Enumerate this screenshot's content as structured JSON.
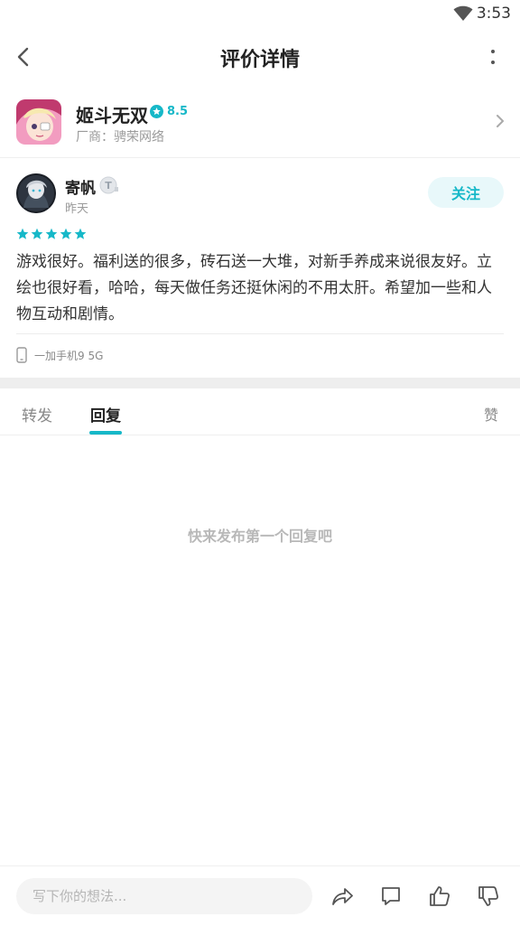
{
  "status": {
    "time": "3:53",
    "wifi_icon": "wifi-icon"
  },
  "header": {
    "title": "评价详情",
    "back_icon": "back-arrow-icon",
    "more_icon": "more-vertical-icon"
  },
  "app": {
    "name": "姬斗无双",
    "rating": "8.5",
    "vendor": "厂商：骋荣网络",
    "icon": "app-icon"
  },
  "review": {
    "user": "寄帆",
    "badge": "T",
    "date": "昨天",
    "follow_label": "关注",
    "stars": 5,
    "text": "游戏很好。福利送的很多，砖石送一大堆，对新手养成来说很友好。立绘也很好看，哈哈，每天做任务还挺休闲的不用太肝。希望加一些和人物互动和剧情。",
    "device": "一加手机9 5G"
  },
  "tabs": {
    "forward": "转发",
    "reply": "回复",
    "likes": "赞"
  },
  "empty_state": "快来发布第一个回复吧",
  "composer": {
    "placeholder": "写下你的想法..."
  },
  "colors": {
    "accent": "#16b8c8",
    "follow_bg": "#e8f8fa"
  }
}
